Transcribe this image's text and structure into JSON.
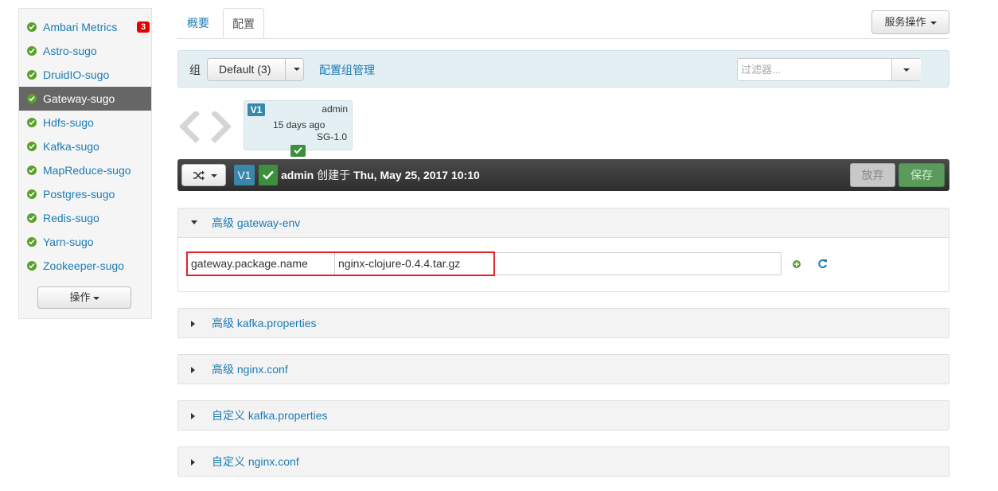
{
  "sidebar": {
    "services": [
      {
        "name": "Ambari Metrics",
        "alerts": "3"
      },
      {
        "name": "Astro-sugo"
      },
      {
        "name": "DruidIO-sugo"
      },
      {
        "name": "Gateway-sugo",
        "active": true
      },
      {
        "name": "Hdfs-sugo"
      },
      {
        "name": "Kafka-sugo"
      },
      {
        "name": "MapReduce-sugo"
      },
      {
        "name": "Postgres-sugo"
      },
      {
        "name": "Redis-sugo"
      },
      {
        "name": "Yarn-sugo"
      },
      {
        "name": "Zookeeper-sugo"
      }
    ],
    "actions_label": "操作"
  },
  "tabs": [
    {
      "label": "概要"
    },
    {
      "label": "配置",
      "active": true
    }
  ],
  "service_actions_label": "服务操作",
  "group_bar": {
    "label": "组",
    "selected": "Default (3)",
    "manage_link": "配置组管理",
    "filter_placeholder": "过滤器..."
  },
  "version_card": {
    "version": "V1",
    "author": "admin",
    "time": "15 days ago",
    "stack": "SG-1.0"
  },
  "version_bar": {
    "version": "V1",
    "author": "admin",
    "created_label": "创建于",
    "date": "Thu, May 25, 2017 10:10",
    "discard_label": "放弃",
    "save_label": "保存"
  },
  "sections": [
    {
      "title": "高级 gateway-env",
      "expanded": true
    },
    {
      "title": "高级 kafka.properties"
    },
    {
      "title": "高级 nginx.conf"
    },
    {
      "title": "自定义 kafka.properties"
    },
    {
      "title": "自定义 nginx.conf"
    }
  ],
  "property": {
    "name": "gateway.package.name",
    "value": "nginx-clojure-0.4.4.tar.gz"
  },
  "colors": {
    "link": "#1c7cb6",
    "ok": "#5aa12b",
    "alert": "#e80000",
    "save": "#5a9a5a",
    "highlight": "#e2232a"
  }
}
